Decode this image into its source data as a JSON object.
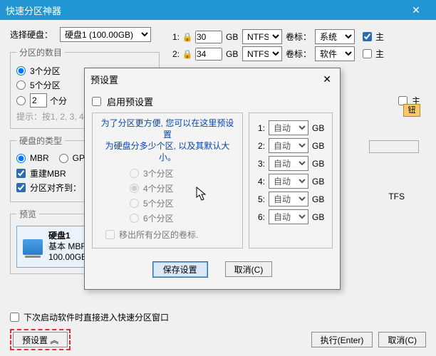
{
  "window": {
    "title": "快速分区神器"
  },
  "topbar": {
    "disk_label": "选择硬盘：",
    "disk_value": "硬盘1 (100.00GB)"
  },
  "count_group": {
    "legend": "分区的数目",
    "r3": "3个分区",
    "r5": "5个分区",
    "custom_suffix": "个分",
    "custom_value": "2",
    "hint": "提示：按1, 2, 3, 4"
  },
  "disk_type": {
    "legend": "硬盘的类型",
    "mbr": "MBR",
    "gpt": "GPT",
    "rebuild": "重建MBR",
    "align": "分区对齐到："
  },
  "preview": {
    "legend": "预览",
    "name": "硬盘1",
    "type": "基本 MBR",
    "size": "100.00GB"
  },
  "partitions": [
    {
      "idx": "1:",
      "locked": true,
      "size": "30",
      "unit": "GB",
      "fs": "NTFS",
      "vol_label": "卷标：",
      "vol": "系统",
      "primary": true
    },
    {
      "idx": "2:",
      "locked": true,
      "size": "34",
      "unit": "GB",
      "fs": "NTFS",
      "vol_label": "卷标：",
      "vol": "软件",
      "primary": false
    }
  ],
  "primary_label": "主",
  "extra_primary": "主",
  "modal": {
    "title": "预设置",
    "enable": "启用预设置",
    "hint1": "为了分区更方便, 您可以在这里预设置",
    "hint2": "为硬盘分多少个区, 以及其默认大小。",
    "opts": [
      "3个分区",
      "4个分区",
      "5个分区",
      "6个分区"
    ],
    "remove": "移出所有分区的卷标.",
    "sizes": [
      {
        "n": "1:",
        "v": "自动",
        "g": "GB"
      },
      {
        "n": "2:",
        "v": "自动",
        "g": "GB"
      },
      {
        "n": "3:",
        "v": "自动",
        "g": "GB"
      },
      {
        "n": "4:",
        "v": "自动",
        "g": "GB"
      },
      {
        "n": "5:",
        "v": "自动",
        "g": "GB"
      },
      {
        "n": "6:",
        "v": "自动",
        "g": "GB"
      }
    ],
    "save": "保存设置",
    "cancel": "取消(C)"
  },
  "stray": {
    "ntfs": "TFS",
    "btn_bg": "钮"
  },
  "footer": {
    "startup": "下次启动软件时直接进入快速分区窗口",
    "preset": "预设置",
    "exec": "执行(Enter)",
    "cancel": "取消(C)"
  }
}
